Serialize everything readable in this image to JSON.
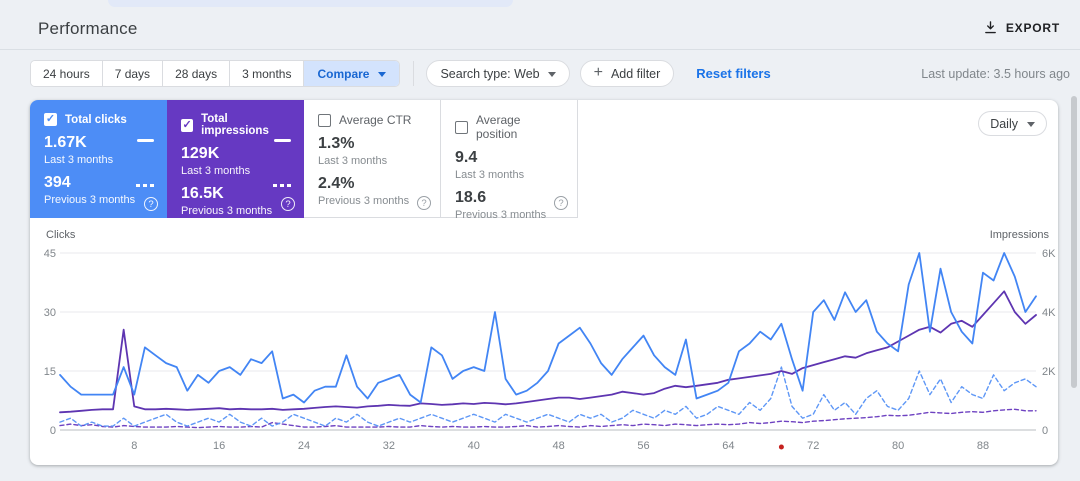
{
  "page": {
    "title": "Performance",
    "export_label": "EXPORT",
    "reset_filters": "Reset filters",
    "last_update": "Last update: 3.5 hours ago"
  },
  "filters": {
    "ranges": [
      "24 hours",
      "7 days",
      "28 days",
      "3 months"
    ],
    "compare": "Compare",
    "search_type": "Search type: Web",
    "add_filter": "Add filter",
    "interval": "Daily"
  },
  "colors": {
    "clicks_tile": "#4d8df6",
    "impressions_tile": "#6639c2",
    "clicks_line": "#4285f4",
    "clicks_prev_line": "#5e97f6",
    "impressions_line": "#5e35b1",
    "impressions_prev_line": "#6e42c1",
    "compare_chip_bg": "#d3e3fd",
    "link_blue": "#1a73e8",
    "red_dot": "#c5221f"
  },
  "metrics": [
    {
      "label": "Total clicks",
      "checked": true,
      "color": "#4d8df6",
      "current": "1.67K",
      "current_caption": "Last 3 months",
      "previous": "394",
      "previous_caption": "Previous 3 months"
    },
    {
      "label": "Total impressions",
      "checked": true,
      "color": "#6639c2",
      "current": "129K",
      "current_caption": "Last 3 months",
      "previous": "16.5K",
      "previous_caption": "Previous 3 months"
    },
    {
      "label": "Average CTR",
      "checked": false,
      "color": "#ffffff",
      "current": "1.3%",
      "current_caption": "Last 3 months",
      "previous": "2.4%",
      "previous_caption": "Previous 3 months"
    },
    {
      "label": "Average position",
      "checked": false,
      "color": "#ffffff",
      "current": "9.4",
      "current_caption": "Last 3 months",
      "previous": "18.6",
      "previous_caption": "Previous 3 months"
    }
  ],
  "chart_data": {
    "type": "line",
    "left_axis": {
      "label": "Clicks",
      "ticks": [
        0,
        15,
        30,
        45
      ],
      "max": 45
    },
    "right_axis": {
      "label": "Impressions",
      "ticks": [
        "0",
        "2K",
        "4K",
        "6K"
      ],
      "tick_values": [
        0,
        2000,
        4000,
        6000
      ],
      "max": 6000
    },
    "x_ticks": [
      8,
      16,
      24,
      32,
      40,
      48,
      56,
      64,
      72,
      80,
      88
    ],
    "x_range": [
      1,
      93
    ],
    "grid": true,
    "red_dot": {
      "day": 69
    },
    "series": [
      {
        "name": "Total impressions — Previous 3 months",
        "axis": "right",
        "style": "dashed",
        "color": "#6e42c1",
        "values": [
          150,
          200,
          150,
          180,
          120,
          100,
          150,
          120,
          100,
          100,
          100,
          120,
          100,
          80,
          100,
          120,
          100,
          100,
          120,
          100,
          250,
          200,
          150,
          100,
          100,
          120,
          150,
          100,
          100,
          100,
          100,
          120,
          100,
          100,
          150,
          120,
          100,
          120,
          100,
          100,
          120,
          100,
          100,
          120,
          150,
          100,
          120,
          150,
          120,
          100,
          150,
          120,
          150,
          180,
          150,
          200,
          180,
          150,
          200,
          180,
          150,
          180,
          200,
          180,
          200,
          250,
          220,
          250,
          300,
          280,
          250,
          300,
          320,
          350,
          380,
          400,
          420,
          450,
          500,
          480,
          500,
          550,
          600,
          580,
          560,
          600,
          620,
          600,
          650,
          680,
          700,
          650,
          650
        ]
      },
      {
        "name": "Total clicks — Previous 3 months",
        "axis": "left",
        "style": "dashed",
        "color": "#5e97f6",
        "values": [
          2,
          3,
          1,
          2,
          1,
          1,
          3,
          1,
          2,
          3,
          4,
          2,
          1,
          2,
          3,
          2,
          4,
          2,
          1,
          3,
          1,
          2,
          4,
          3,
          2,
          1,
          3,
          2,
          4,
          2,
          1,
          2,
          3,
          2,
          3,
          4,
          3,
          2,
          3,
          4,
          3,
          2,
          4,
          3,
          2,
          3,
          4,
          3,
          2,
          4,
          3,
          4,
          2,
          3,
          5,
          4,
          3,
          5,
          4,
          6,
          3,
          4,
          6,
          5,
          4,
          7,
          5,
          8,
          16,
          6,
          3,
          4,
          9,
          5,
          7,
          4,
          8,
          10,
          6,
          5,
          8,
          15,
          9,
          13,
          7,
          11,
          9,
          8,
          14,
          10,
          12,
          13,
          11
        ]
      },
      {
        "name": "Total impressions — Last 3 months",
        "axis": "right",
        "style": "solid",
        "color": "#5e35b1",
        "values": [
          600,
          620,
          650,
          680,
          700,
          700,
          3400,
          800,
          700,
          700,
          720,
          700,
          680,
          700,
          720,
          740,
          700,
          720,
          700,
          700,
          720,
          680,
          700,
          720,
          750,
          780,
          800,
          780,
          760,
          800,
          820,
          850,
          830,
          820,
          900,
          880,
          850,
          870,
          900,
          880,
          920,
          900,
          870,
          900,
          950,
          1000,
          1050,
          1100,
          1100,
          1050,
          1100,
          1150,
          1200,
          1300,
          1250,
          1200,
          1250,
          1400,
          1500,
          1450,
          1500,
          1550,
          1600,
          1700,
          1750,
          1800,
          1850,
          1900,
          2000,
          1900,
          2100,
          2200,
          2300,
          2400,
          2500,
          2450,
          2600,
          2700,
          2800,
          3000,
          3200,
          3400,
          3500,
          3300,
          3600,
          3700,
          3500,
          3900,
          4300,
          4700,
          4000,
          3600,
          3900
        ]
      },
      {
        "name": "Total clicks — Last 3 months",
        "axis": "left",
        "style": "solid",
        "color": "#4285f4",
        "values": [
          14,
          11,
          9,
          9,
          9,
          9,
          16,
          9,
          21,
          19,
          17,
          16,
          10,
          14,
          12,
          15,
          16,
          14,
          18,
          17,
          20,
          8,
          9,
          7,
          10,
          11,
          11,
          19,
          11,
          8,
          12,
          13,
          14,
          9,
          7,
          21,
          19,
          13,
          15,
          16,
          15,
          30,
          13,
          9,
          10,
          12,
          15,
          22,
          24,
          26,
          22,
          17,
          14,
          18,
          21,
          24,
          19,
          16,
          14,
          23,
          8,
          9,
          10,
          12,
          20,
          22,
          25,
          23,
          27,
          18,
          10,
          30,
          33,
          28,
          35,
          30,
          33,
          25,
          22,
          20,
          37,
          45,
          25,
          41,
          30,
          25,
          22,
          40,
          38,
          45,
          39,
          30,
          34
        ]
      }
    ]
  }
}
